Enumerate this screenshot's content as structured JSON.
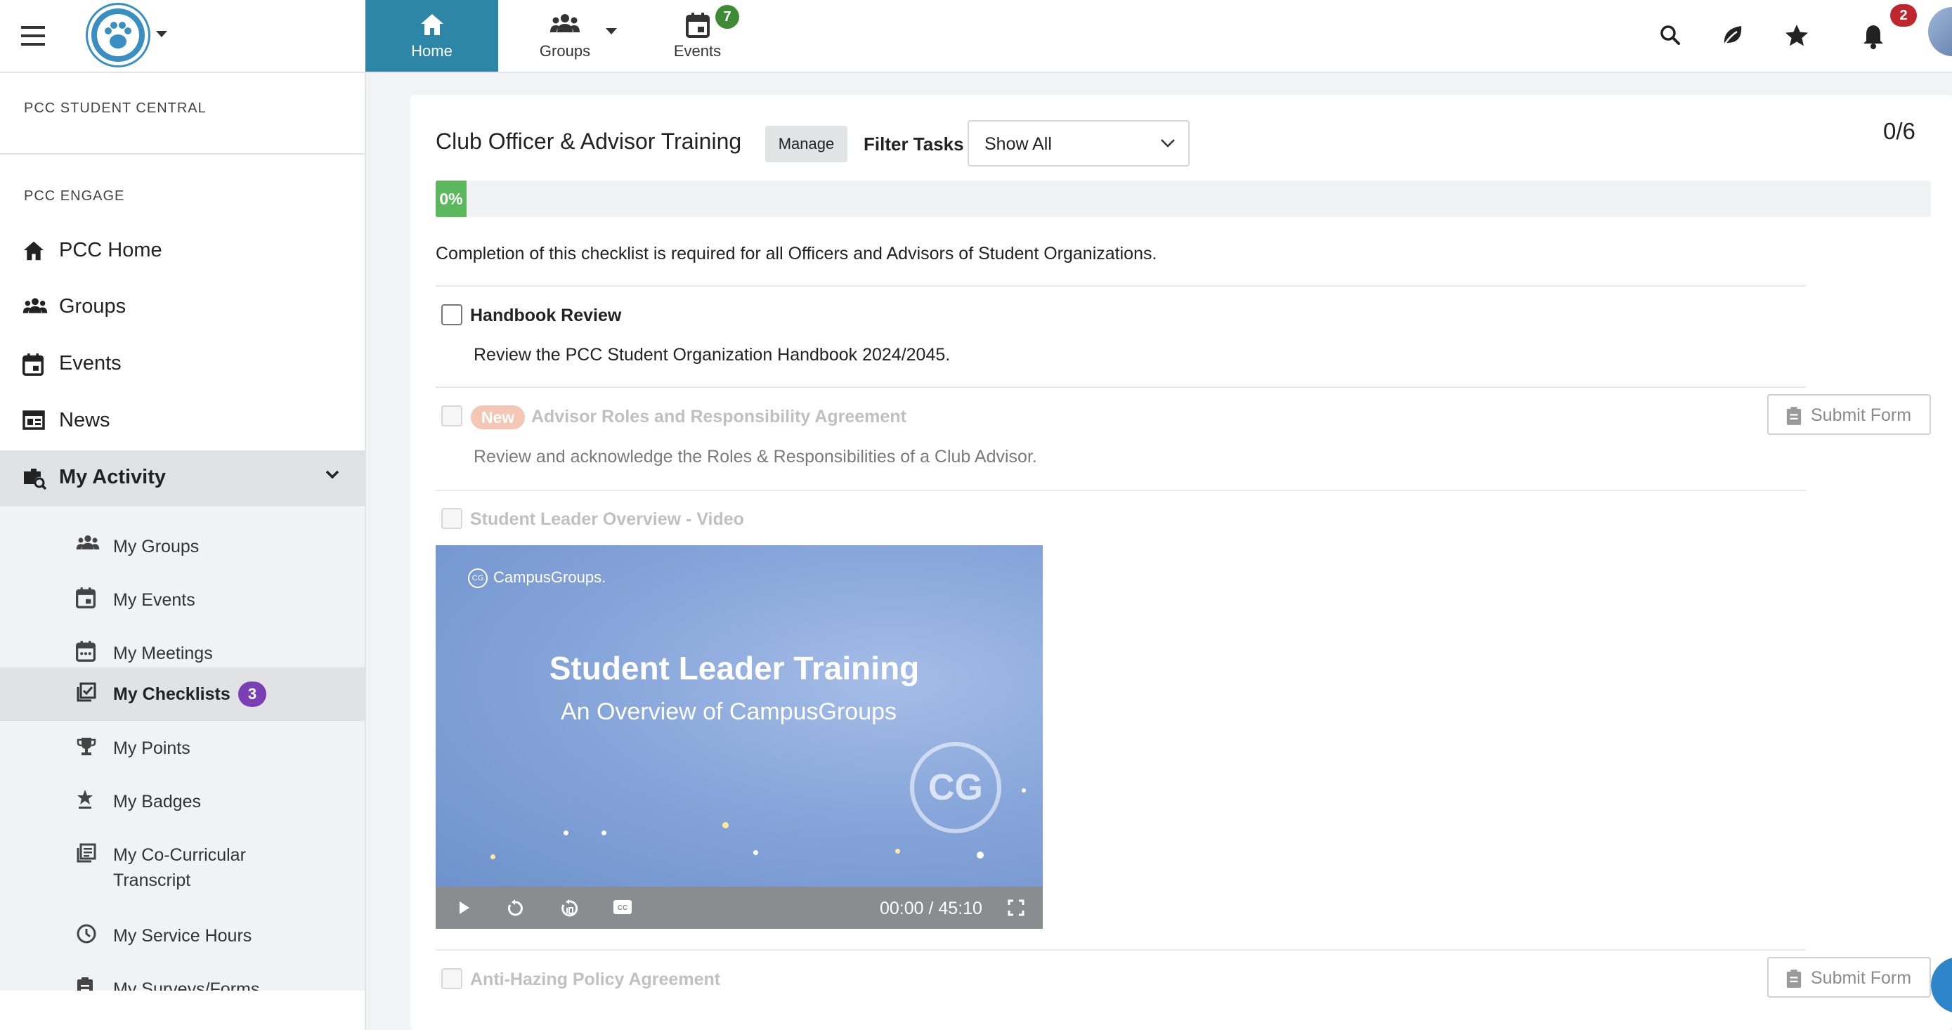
{
  "colors": {
    "primary": "#2e86a6",
    "success": "#5cb85c",
    "danger": "#c0262d",
    "badge_purple": "#7a3fb5",
    "badge_green": "#3f8a35",
    "new_badge": "#f4c6b4"
  },
  "topnav": {
    "icons": [
      "menu-icon",
      "paw-logo",
      "search-icon",
      "leaf-icon",
      "star-icon",
      "bell-icon"
    ],
    "items": [
      {
        "label": "Home",
        "icon": "home-icon",
        "active": true
      },
      {
        "label": "Groups",
        "icon": "groups-icon"
      },
      {
        "label": "Events",
        "icon": "calendar-icon",
        "badge": "7"
      }
    ],
    "notifications_badge": "2"
  },
  "sidebar": {
    "section1": "PCC STUDENT CENTRAL",
    "section2": "PCC ENGAGE",
    "main_items": [
      {
        "label": "PCC Home",
        "icon": "home-icon"
      },
      {
        "label": "Groups",
        "icon": "groups-icon"
      },
      {
        "label": "Events",
        "icon": "calendar-icon"
      },
      {
        "label": "News",
        "icon": "newspaper-icon"
      },
      {
        "label": "My Activity",
        "icon": "activity-icon",
        "expanded": true
      }
    ],
    "sub_items": [
      {
        "label": "My Groups",
        "icon": "groups-icon"
      },
      {
        "label": "My Events",
        "icon": "calendar-icon"
      },
      {
        "label": "My Meetings",
        "icon": "meetings-icon"
      },
      {
        "label": "My Checklists",
        "icon": "checklist-icon",
        "badge": "3",
        "active": true
      },
      {
        "label": "My Points",
        "icon": "trophy-icon"
      },
      {
        "label": "My Badges",
        "icon": "badge-icon"
      },
      {
        "label": "My Co-Curricular Transcript",
        "icon": "transcript-icon"
      },
      {
        "label": "My Service Hours",
        "icon": "clock-icon"
      },
      {
        "label": "My Surveys/Forms",
        "icon": "clipboard-icon"
      }
    ]
  },
  "checklist": {
    "title": "Club Officer & Advisor Training",
    "manage_label": "Manage",
    "filter_label": "Filter Tasks",
    "filter_value": "Show All",
    "count": "0/6",
    "progress_label": "0%",
    "progress_fraction": 0,
    "description": "Completion of this checklist is required for all Officers and Advisors of Student Organizations.",
    "tasks": [
      {
        "title": "Handbook Review",
        "description": "Review the PCC Student Organization Handbook 2024/2045.",
        "enabled": true
      },
      {
        "title": "Advisor Roles and Responsibility Agreement",
        "badge": "New",
        "description": "Review and acknowledge the Roles & Responsibilities of a Club Advisor.",
        "enabled": false,
        "action": "Submit Form"
      },
      {
        "title": "Student Leader Overview - Video",
        "enabled": false
      },
      {
        "title": "Anti-Hazing Policy Agreement",
        "enabled": false,
        "action": "Submit Form"
      }
    ]
  },
  "video": {
    "brand_badge": "CG",
    "brand": "CampusGroups.",
    "title": "Student Leader Training",
    "subtitle": "An Overview of CampusGroups",
    "emblem": "CG",
    "time": "00:00 / 45:10",
    "cc_label": "CC"
  }
}
